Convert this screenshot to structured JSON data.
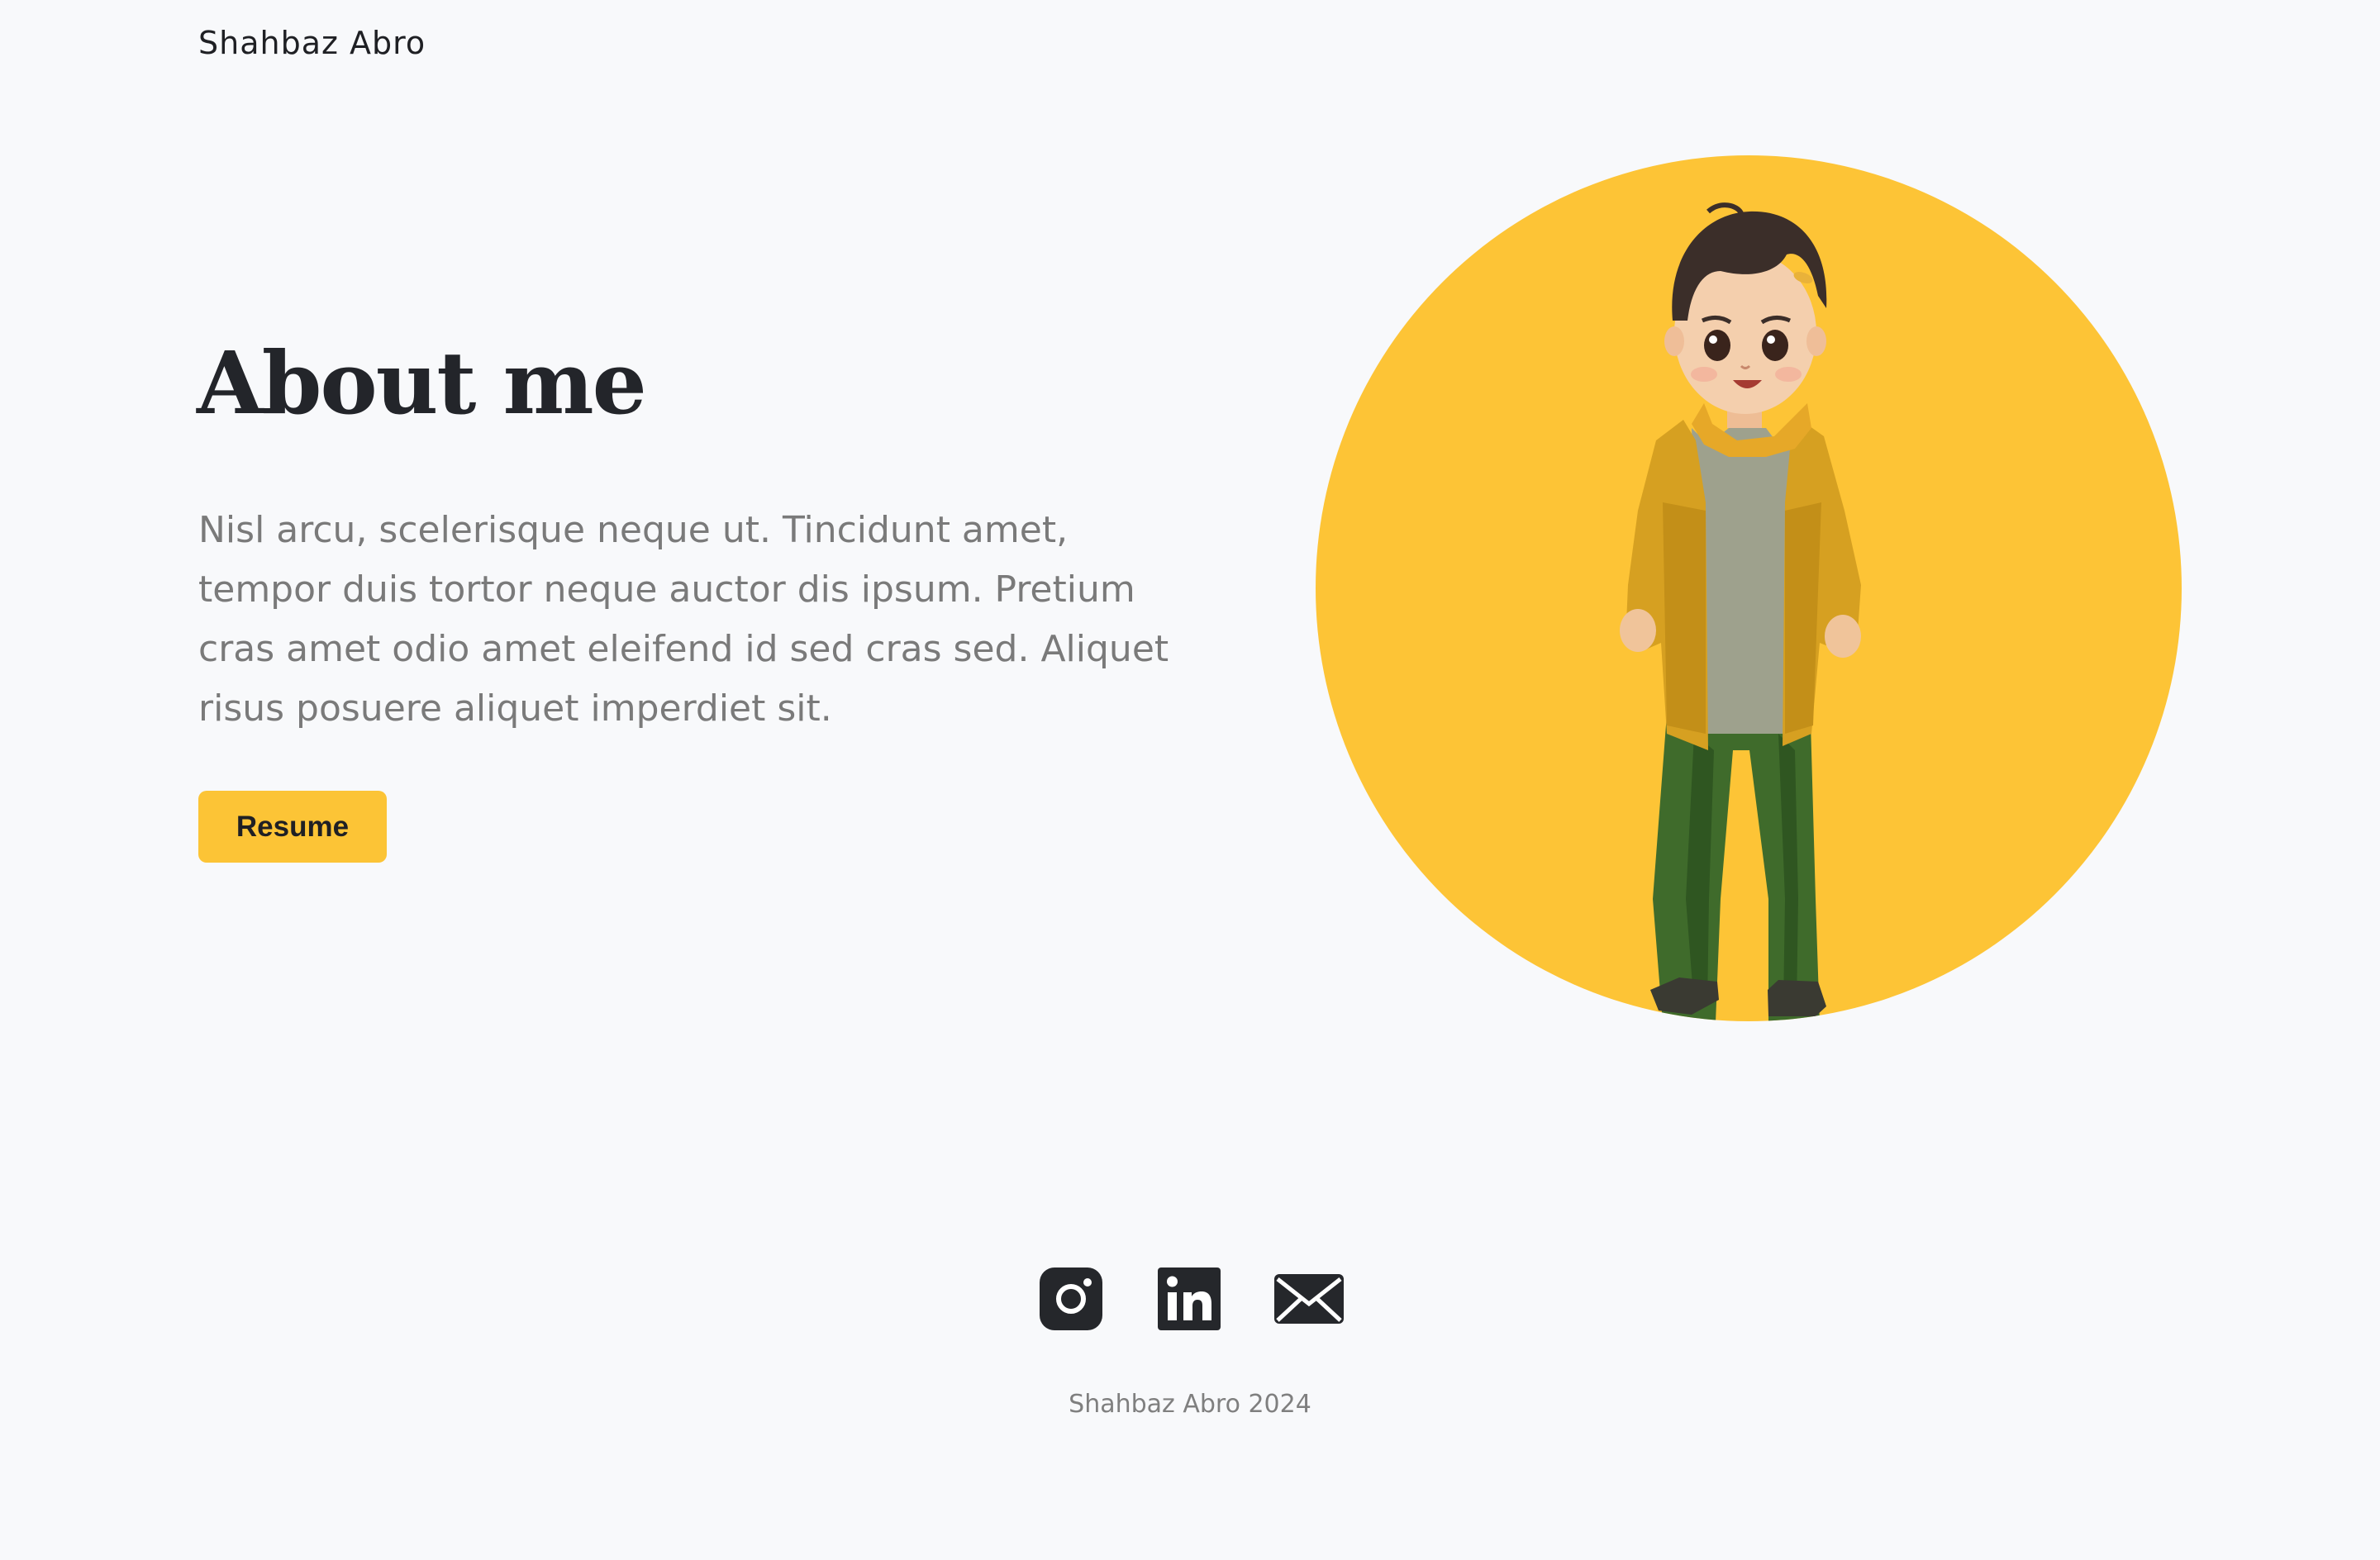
{
  "header": {
    "brand": "Shahbaz Abro"
  },
  "hero": {
    "title": "About me",
    "description": "Nisl arcu, scelerisque neque ut. Tincidunt amet, tempor duis tortor neque auctor dis ipsum. Pretium cras amet odio amet eleifend id sed cras sed. Aliquet risus posuere aliquet imperdiet sit.",
    "resume_label": "Resume",
    "portrait_icon": "avatar-illustration"
  },
  "social": {
    "items": [
      {
        "icon": "instagram-icon"
      },
      {
        "icon": "linkedin-icon"
      },
      {
        "icon": "mail-icon"
      }
    ]
  },
  "footer": {
    "text": "Shahbaz Abro 2024"
  },
  "colors": {
    "background": "#f8f9fb",
    "accent": "#fcc436",
    "text_dark": "#23252a",
    "text_muted": "#7a7a7a"
  }
}
